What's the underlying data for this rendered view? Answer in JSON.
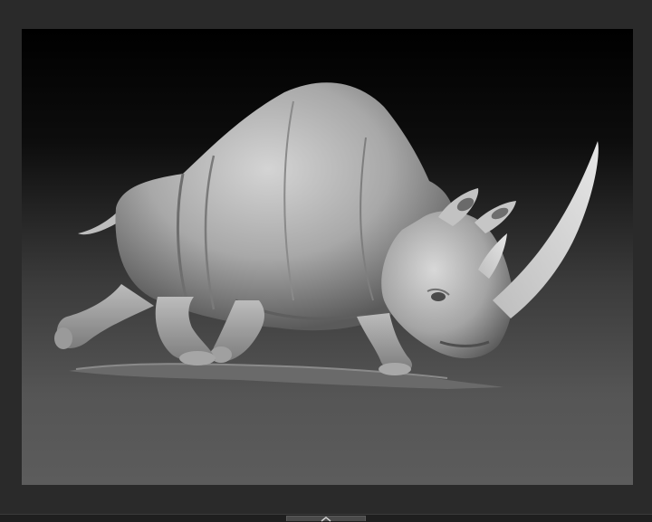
{
  "colors": {
    "app_background": "#2a2a2a",
    "viewport_top": "#000000",
    "viewport_bottom": "#5c5c5c",
    "bottom_bar": "#1f1f1f",
    "model_clay": "#b4b4b4"
  },
  "viewport": {
    "model_subject": "rhino-sculpt"
  },
  "bottom_bar": {
    "handle_icon": "collapse-icon"
  }
}
